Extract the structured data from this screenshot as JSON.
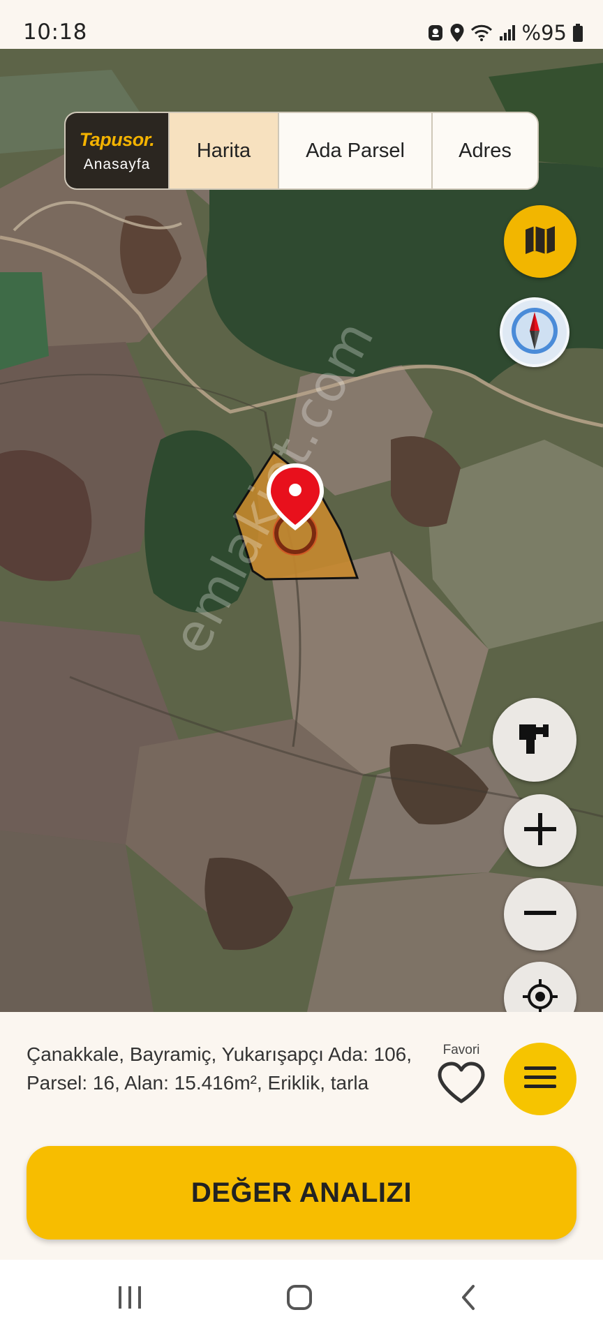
{
  "status_bar": {
    "time": "10:18",
    "battery": "%95",
    "icons": [
      "notification-icon",
      "location-icon",
      "wifi-icon",
      "signal-icon",
      "battery-icon"
    ]
  },
  "tabs": {
    "logo": "Tapusor.",
    "logo_sub": "Anasayfa",
    "items": [
      {
        "label": "Harita",
        "active": true
      },
      {
        "label": "Ada Parsel",
        "active": false
      },
      {
        "label": "Adres",
        "active": false
      }
    ]
  },
  "map": {
    "watermark": "emlakjet.com",
    "controls": [
      "map-layers-icon",
      "compass-icon",
      "measure-icon",
      "zoom-in-icon",
      "zoom-out-icon",
      "my-location-icon"
    ]
  },
  "info": {
    "parcel_text": "Çanakkale, Bayramiç, Yukarışapçı Ada: 106, Parsel: 16, Alan: 15.416m², Eriklik, tarla",
    "favorite_label": "Favori"
  },
  "cta": {
    "label": "DEĞER ANALIZI"
  },
  "colors": {
    "accent": "#f7bd00",
    "parcel_fill": "#c98a2e",
    "pin": "#e8101c"
  }
}
